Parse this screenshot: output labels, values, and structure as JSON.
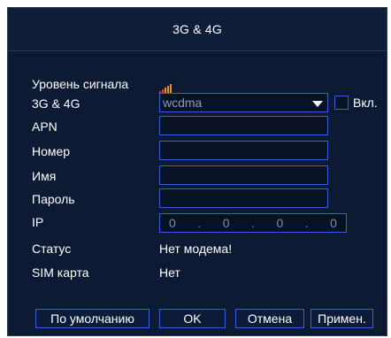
{
  "dialog": {
    "title": "3G & 4G"
  },
  "form": {
    "signal_label": "Уровень сигнала",
    "signal_icon": "signal-bars-icon",
    "network_label": "3G & 4G",
    "network_value": "wcdma",
    "enable_label": "Вкл.",
    "apn_label": "APN",
    "apn_value": "",
    "number_label": "Номер",
    "number_value": "",
    "name_label": "Имя",
    "name_value": "",
    "password_label": "Пароль",
    "password_value": "",
    "ip_label": "IP",
    "ip_octets": [
      "0",
      "0",
      "0",
      "0"
    ],
    "status_label": "Статус",
    "status_value": "Нет модема!",
    "sim_label": "SIM карта",
    "sim_value": "Нет"
  },
  "buttons": {
    "default": "По умолчанию",
    "ok": "OK",
    "cancel": "Отмена",
    "apply": "Примен."
  },
  "colors": {
    "background": "#0c1a33",
    "border": "#3c5cdc",
    "signal_red": "#e23b2e",
    "signal_orange": "#f08c2a"
  }
}
